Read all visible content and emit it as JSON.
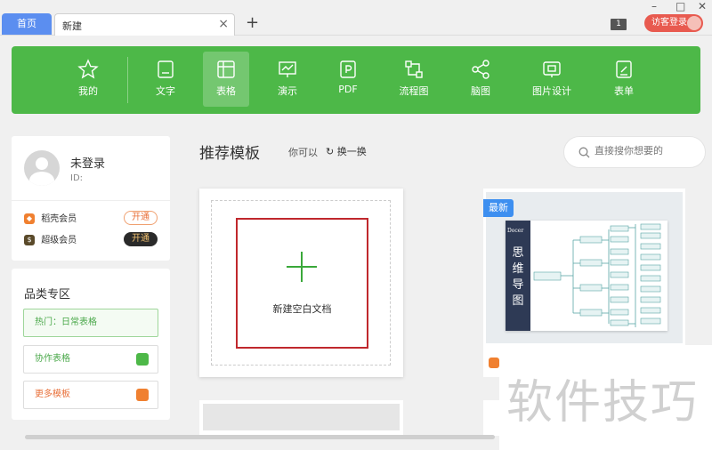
{
  "tabs": {
    "home_label": "首页",
    "new_label": "新建",
    "close_glyph": "×",
    "add_glyph": "+"
  },
  "titlebar": {
    "window_count": "1",
    "guest_login": "访客登录"
  },
  "toolbar": {
    "items": [
      {
        "label": "我的",
        "icon": "star-icon"
      },
      {
        "label": "文字",
        "icon": "document-icon"
      },
      {
        "label": "表格",
        "icon": "table-icon"
      },
      {
        "label": "演示",
        "icon": "presentation-icon"
      },
      {
        "label": "PDF",
        "icon": "pdf-icon"
      },
      {
        "label": "流程图",
        "icon": "flowchart-icon"
      },
      {
        "label": "脑图",
        "icon": "mindmap-icon"
      },
      {
        "label": "图片设计",
        "icon": "image-design-icon"
      },
      {
        "label": "表单",
        "icon": "form-icon"
      }
    ],
    "active": "表格"
  },
  "user": {
    "name": "未登录",
    "id_label": "ID:",
    "memberships": [
      {
        "label": "稻壳会员",
        "button": "开通",
        "icon_color": "#f08030"
      },
      {
        "label": "超级会员",
        "button": "开通",
        "icon_color": "#5a4a2a"
      }
    ]
  },
  "category": {
    "title": "品类专区",
    "items": [
      {
        "label": "热门：日常表格"
      },
      {
        "label": "协作表格"
      },
      {
        "label": "更多模板"
      }
    ]
  },
  "main": {
    "title": "推荐模板",
    "maybe_label": "你可以",
    "refresh_label": "换一换",
    "search_placeholder": "直接搜你想要的",
    "new_blank_label": "新建空白文档",
    "template_badge": "最新",
    "mindmap_title": "思维导图",
    "mindmap_logo": "Docer"
  },
  "watermark": "软件技巧",
  "colors": {
    "toolbar_green": "#4db848",
    "home_tab_blue": "#5b8ef0",
    "guest_red": "#e85a4f",
    "badge_blue": "#3d8ff0"
  }
}
